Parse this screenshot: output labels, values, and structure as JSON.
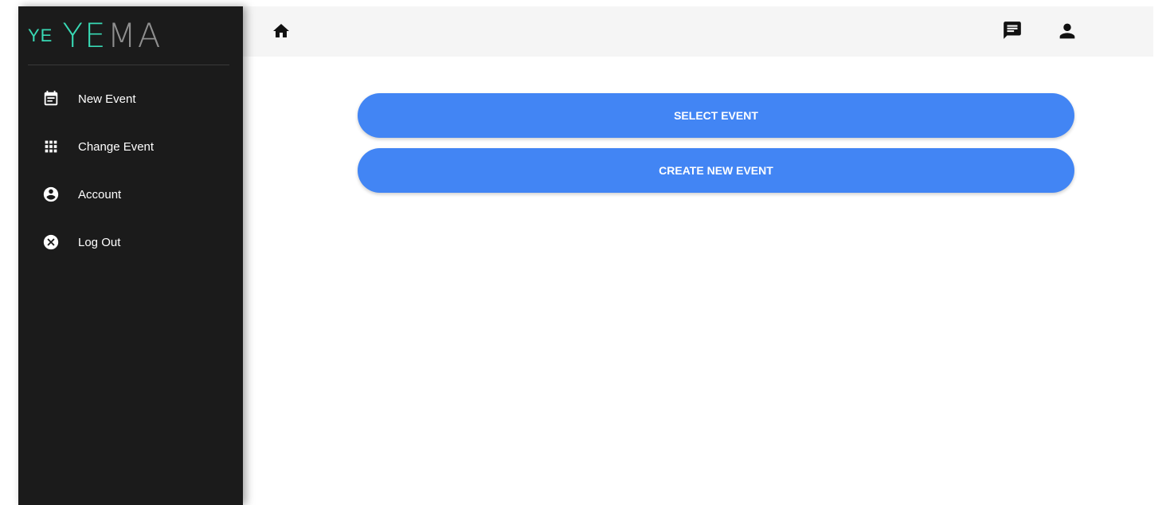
{
  "brand": {
    "small": "YE",
    "big_accent": "YE",
    "big_rest": "MA"
  },
  "sidebar": {
    "items": [
      {
        "label": "New Event",
        "icon": "event-note-icon"
      },
      {
        "label": "Change Event",
        "icon": "apps-grid-icon"
      },
      {
        "label": "Account",
        "icon": "account-circle-icon"
      },
      {
        "label": "Log Out",
        "icon": "cancel-icon"
      }
    ]
  },
  "topbar": {
    "icons": [
      "home-icon",
      "chat-icon",
      "person-icon"
    ]
  },
  "main": {
    "select_event_label": "SELECT EVENT",
    "create_event_label": "CREATE NEW EVENT"
  },
  "colors": {
    "sidebar_bg": "#1b1b1b",
    "brand_accent": "#38d9b4",
    "button_primary": "#4285f4",
    "topbar_bg": "#f5f5f5"
  }
}
